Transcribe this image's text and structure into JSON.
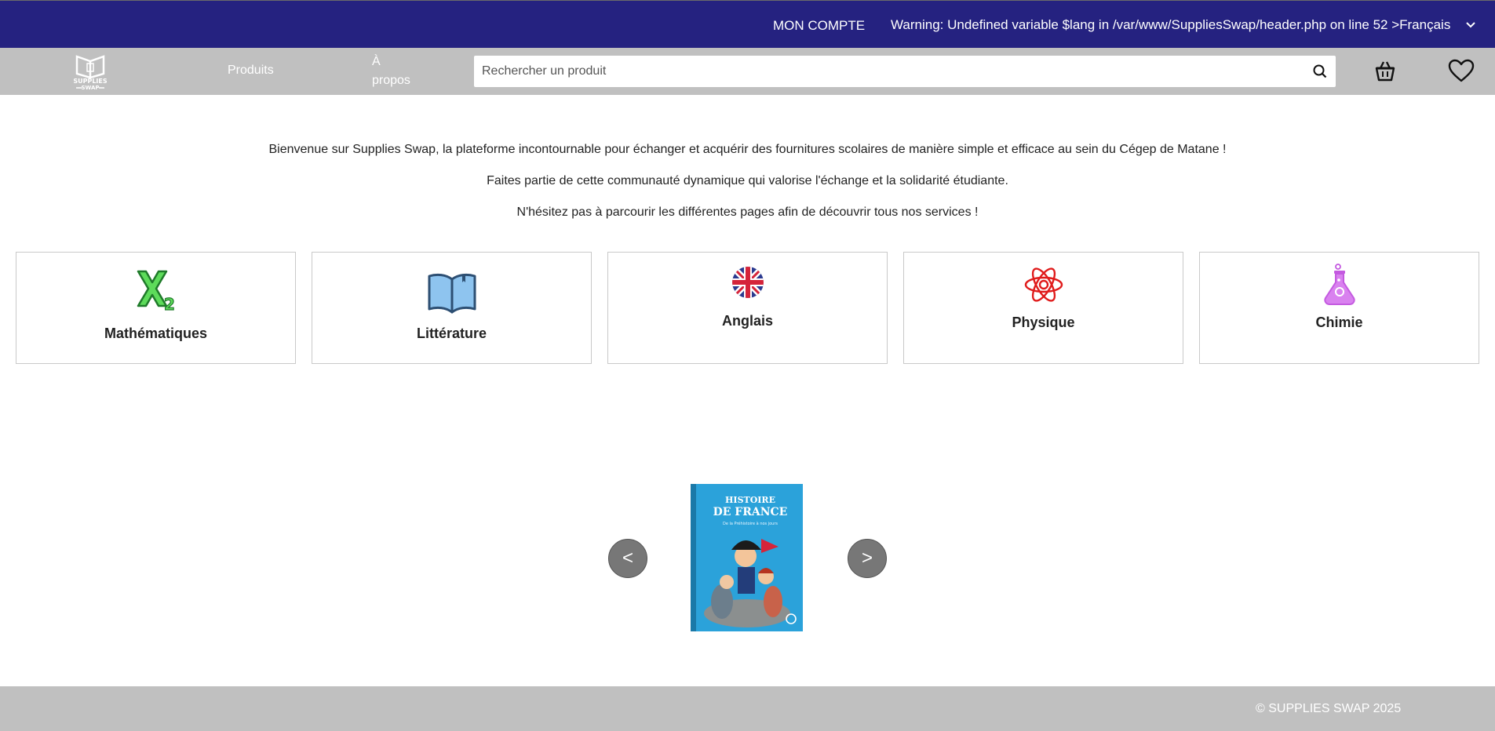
{
  "header": {
    "account_label": "MON COMPTE",
    "language_label": "Warning: Undefined variable $lang in /var/www/SuppliesSwap/header.php on line 52 >Français"
  },
  "nav": {
    "logo_text": [
      "SUPPLIES",
      "SWAP"
    ],
    "products": "Produits",
    "about": "À propos",
    "search_placeholder": "Rechercher un produit"
  },
  "intro": {
    "line1": "Bienvenue sur Supplies Swap, la plateforme incontournable pour échanger et acquérir des fournitures scolaires de manière simple et efficace au sein du Cégep de Matane !",
    "line2": "Faites partie de cette communauté dynamique qui valorise l'échange et la solidarité étudiante.",
    "line3": "N'hésitez pas à parcourir les différentes pages afin de découvrir tous nos services !"
  },
  "categories": [
    {
      "label": "Mathématiques",
      "icon": "math-x2-icon",
      "color": "#2ecc40"
    },
    {
      "label": "Littérature",
      "icon": "open-book-icon",
      "color": "#3b6ea5"
    },
    {
      "label": "Anglais",
      "icon": "uk-flag-icon",
      "color": "#c8102e"
    },
    {
      "label": "Physique",
      "icon": "atom-icon",
      "color": "#e01b1b"
    },
    {
      "label": "Chimie",
      "icon": "flask-icon",
      "color": "#c45ae0"
    }
  ],
  "carousel": {
    "prev_label": "<",
    "next_label": ">",
    "book_title_line1": "HISTOIRE",
    "book_title_line2": "DE FRANCE",
    "book_subtitle": "De la Préhistoire à nos jours"
  },
  "footer": {
    "copyright": "© SUPPLIES SWAP 2025"
  },
  "colors": {
    "topbar": "#252280",
    "navbar": "#c0c0c0",
    "footer": "#c0c0c0",
    "carousel_button": "#777777",
    "book_cover": "#29a3dc"
  }
}
